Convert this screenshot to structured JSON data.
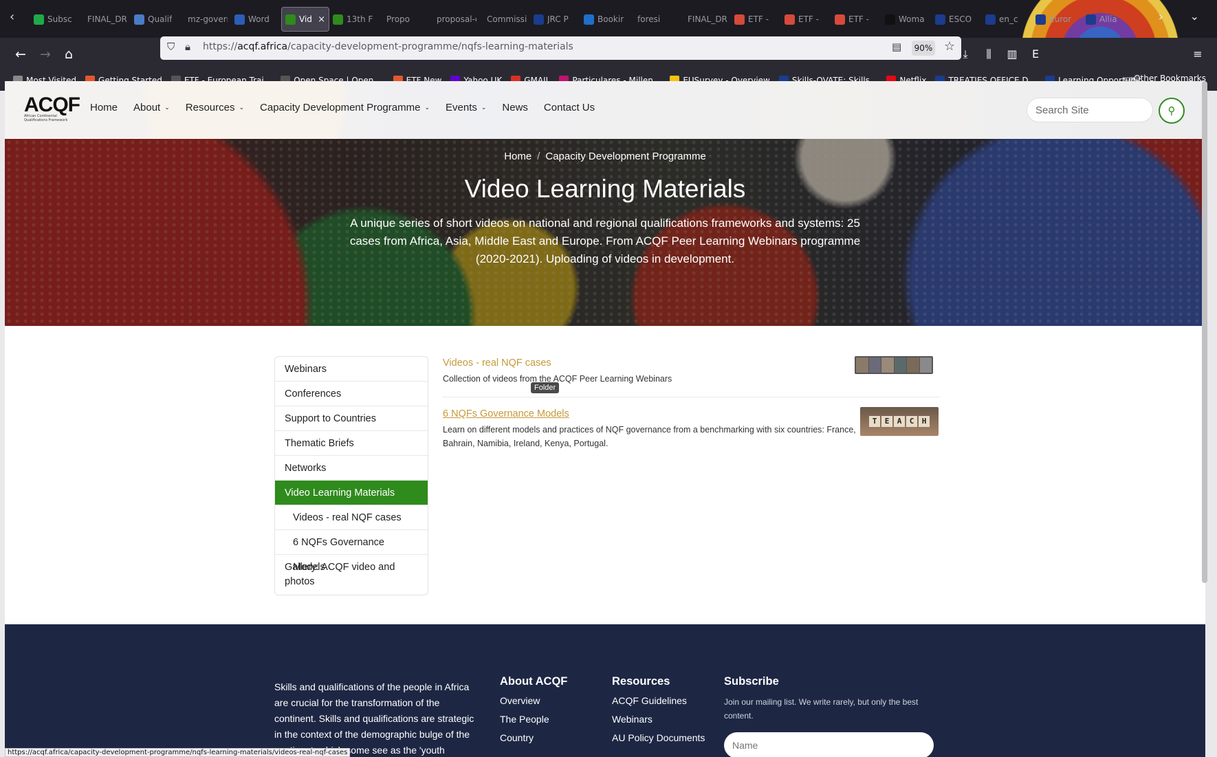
{
  "browser": {
    "tabs": [
      {
        "title": "Subsc",
        "color": "#1faa4a"
      },
      {
        "title": "FINAL_DR",
        "color": ""
      },
      {
        "title": "Qualif",
        "color": "#4a7cc6"
      },
      {
        "title": "mz-govern",
        "color": ""
      },
      {
        "title": "Word",
        "color": "#2b5fb5"
      },
      {
        "title": "Vid",
        "color": "#2e8b1c",
        "active": true
      },
      {
        "title": "13th F",
        "color": "#2e8b1c"
      },
      {
        "title": "Propo",
        "color": ""
      },
      {
        "title": "proposal-c",
        "color": ""
      },
      {
        "title": "Commissi",
        "color": ""
      },
      {
        "title": "JRC P",
        "color": "#1b3c8f"
      },
      {
        "title": "Bookir",
        "color": "#1f6fc9"
      },
      {
        "title": "foresi",
        "color": ""
      },
      {
        "title": "FINAL_DR",
        "color": ""
      },
      {
        "title": "ETF -",
        "color": "#d64a3a"
      },
      {
        "title": "ETF -",
        "color": "#d64a3a"
      },
      {
        "title": "ETF -",
        "color": "#d64a3a"
      },
      {
        "title": "Woma",
        "color": "#111111"
      },
      {
        "title": "ESCO",
        "color": "#1b3c8f"
      },
      {
        "title": "en_c",
        "color": "#1b3c8f"
      },
      {
        "title": "Euror",
        "color": "#1b3c8f"
      },
      {
        "title": "Allia",
        "color": "#1b3c8f"
      }
    ],
    "url_prefix": "https://",
    "url_domain": "acqf.africa",
    "url_path": "/capacity-development-programme/nqfs-learning-materials",
    "zoom": "90%",
    "bookmarks": [
      {
        "label": "Most Visited",
        "color": "#888888"
      },
      {
        "label": "Getting Started",
        "color": "#e4572e"
      },
      {
        "label": "ETF - European Trai...",
        "color": "#555555"
      },
      {
        "label": "Open Space | Open ...",
        "color": "#555555"
      },
      {
        "label": "ETF New",
        "color": "#e4572e"
      },
      {
        "label": "Yahoo UK",
        "color": "#6001d2"
      },
      {
        "label": "GMAIL",
        "color": "#d93025"
      },
      {
        "label": "Particulares - Millen...",
        "color": "#c0136f"
      },
      {
        "label": "EUSurvey - Overview",
        "color": "#f5c211"
      },
      {
        "label": "Skills-OVATE: Skills...",
        "color": "#1b3c8f"
      },
      {
        "label": "Netflix",
        "color": "#e50914"
      },
      {
        "label": "TREATIES OFFICE D...",
        "color": "#1b3c8f"
      },
      {
        "label": "Learning Opportunit...",
        "color": "#1b3c8f"
      }
    ],
    "other_bookmarks": "Other Bookmarks",
    "status_url": "https://acqf.africa/capacity-development-programme/nqfs-learning-materials/videos-real-nqf-cases"
  },
  "site": {
    "logo_text": "ACQF",
    "logo_sub": "African Continental Qualifications Framework",
    "nav": [
      {
        "label": "Home",
        "has_dropdown": false
      },
      {
        "label": "About",
        "has_dropdown": true
      },
      {
        "label": "Resources",
        "has_dropdown": true
      },
      {
        "label": "Capacity Development Programme",
        "has_dropdown": true
      },
      {
        "label": "Events",
        "has_dropdown": true
      },
      {
        "label": "News",
        "has_dropdown": false
      },
      {
        "label": "Contact Us",
        "has_dropdown": false
      }
    ],
    "search_placeholder": "Search Site",
    "accent": "#2e8b1c"
  },
  "hero": {
    "breadcrumb": [
      "Home",
      "Capacity Development Programme"
    ],
    "title": "Video Learning Materials",
    "description": "A unique series of short videos on national and regional qualifications frameworks and systems: 25 cases from Africa, Asia, Middle East and Europe. From ACQF Peer Learning Webinars programme (2020-2021). Uploading of videos in development."
  },
  "sidebar": {
    "items": [
      {
        "label": "Webinars"
      },
      {
        "label": "Conferences"
      },
      {
        "label": "Support to Countries"
      },
      {
        "label": "Thematic Briefs"
      },
      {
        "label": "Networks"
      },
      {
        "label": "Video Learning Materials",
        "active": true
      },
      {
        "label": "Videos - real NQF cases",
        "sub": true
      },
      {
        "label": "6 NQFs Governance Models",
        "sub": true
      },
      {
        "label": "Gallery: ACQF video and photos",
        "multi": true
      }
    ]
  },
  "content": {
    "items": [
      {
        "title": "Videos - real NQF cases",
        "desc": "Collection of videos from the ACQF Peer Learning Webinars",
        "thumb": "video-grid"
      },
      {
        "title": "6 NQFs Governance Models",
        "desc": "Learn on different models and practices of NQF governance from a benchmarking with six countries: France, Bahrain, Namibia, Ireland, Kenya, Portugal.",
        "thumb": "teach"
      }
    ],
    "tooltip": "Folder",
    "thumb_letters": [
      "T",
      "E",
      "A",
      "C",
      "H"
    ]
  },
  "footer": {
    "about": "Skills and qualifications of the people in Africa are crucial for the transformation of the continent. Skills and qualifications are strategic in the context of the demographic bulge of the continent, which some see as the 'youth",
    "about_title": "About ACQF",
    "about_links": [
      "Overview",
      "The People",
      "Country"
    ],
    "resources_title": "Resources",
    "resources_links": [
      "ACQF Guidelines",
      "Webinars",
      "AU Policy Documents"
    ],
    "subscribe_title": "Subscribe",
    "subscribe_text": "Join our mailing list. We write rarely, but only the best content.",
    "name_placeholder": "Name"
  }
}
